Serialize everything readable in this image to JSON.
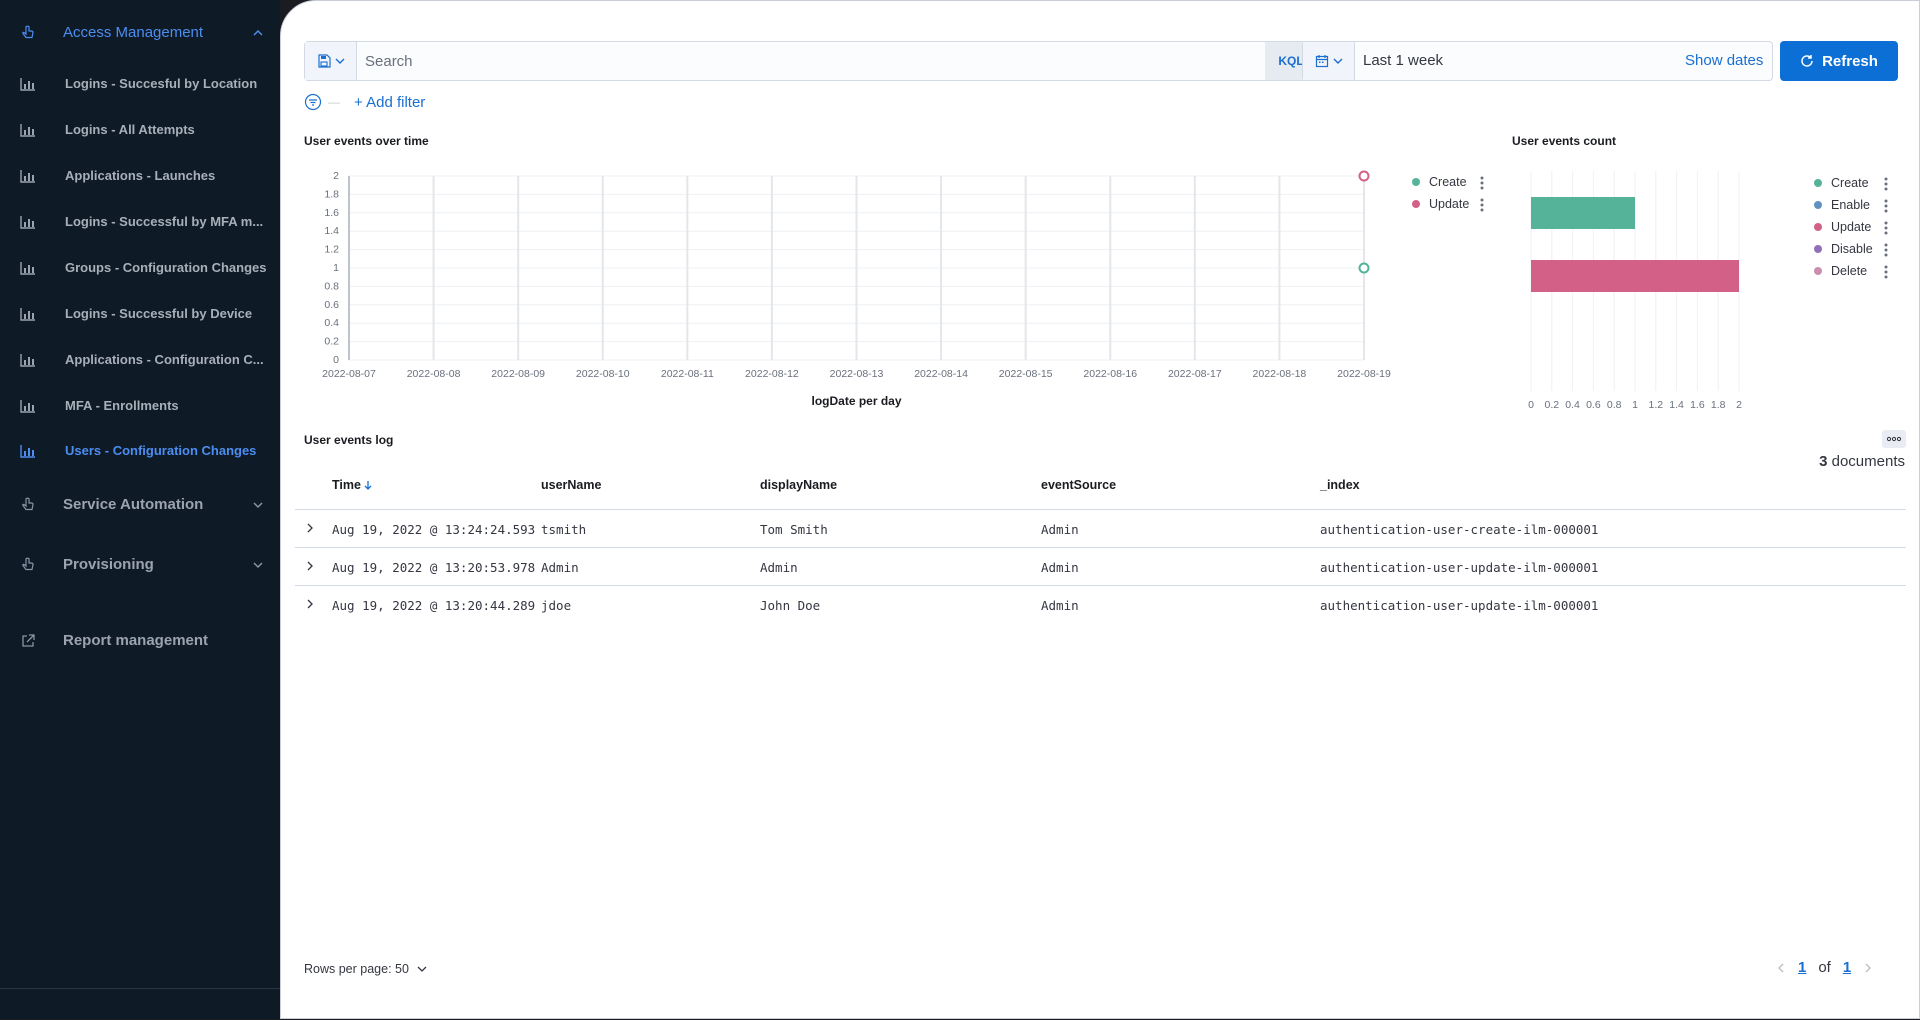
{
  "sidebar": {
    "sections": [
      {
        "label": "Access Management",
        "icon": "hand-pointer-icon",
        "expanded": true
      },
      {
        "label": "Service Automation",
        "icon": "hand-pointer-icon",
        "expanded": false
      },
      {
        "label": "Provisioning",
        "icon": "hand-pointer-icon",
        "expanded": false
      },
      {
        "label": "Report management",
        "icon": "external-link-icon"
      }
    ],
    "items": [
      {
        "label": "Logins - Succesful by Location",
        "icon": "bar-chart-icon"
      },
      {
        "label": "Logins - All Attempts",
        "icon": "bar-chart-icon"
      },
      {
        "label": "Applications - Launches",
        "icon": "bar-chart-icon"
      },
      {
        "label": "Logins - Successful by MFA m...",
        "icon": "bar-chart-icon"
      },
      {
        "label": "Groups - Configuration Changes",
        "icon": "bar-chart-icon"
      },
      {
        "label": "Logins - Successful by Device",
        "icon": "bar-chart-icon"
      },
      {
        "label": "Applications - Configuration C...",
        "icon": "bar-chart-icon"
      },
      {
        "label": "MFA - Enrollments",
        "icon": "bar-chart-icon"
      },
      {
        "label": "Users - Configuration Changes",
        "icon": "bar-chart-icon",
        "active": true
      }
    ]
  },
  "query_bar": {
    "search_placeholder": "Search",
    "language": "KQL",
    "time_range": "Last 1 week",
    "show_dates": "Show dates",
    "refresh": "Refresh",
    "add_filter": "+ Add filter"
  },
  "colors": {
    "accent": "#0b6fd6",
    "create": "#54b399",
    "update": "#d36086",
    "enable": "#6092c0",
    "disable": "#9170b8",
    "delete": "#ca8eae"
  },
  "chart_data": [
    {
      "type": "line",
      "title": "User events over time",
      "xlabel": "logDate per day",
      "ylabel": "",
      "x": [
        "2022-08-07",
        "2022-08-08",
        "2022-08-09",
        "2022-08-10",
        "2022-08-11",
        "2022-08-12",
        "2022-08-13",
        "2022-08-14",
        "2022-08-15",
        "2022-08-16",
        "2022-08-17",
        "2022-08-18",
        "2022-08-19"
      ],
      "yticks": [
        "0",
        "0.2",
        "0.4",
        "0.6",
        "0.8",
        "1",
        "1.2",
        "1.4",
        "1.6",
        "1.8",
        "2"
      ],
      "ylim": [
        0,
        2
      ],
      "series": [
        {
          "name": "Create",
          "points": [
            {
              "x": "2022-08-19",
              "y": 1
            }
          ]
        },
        {
          "name": "Update",
          "points": [
            {
              "x": "2022-08-19",
              "y": 2
            }
          ]
        }
      ],
      "legend": "right",
      "grid": true
    },
    {
      "type": "bar",
      "orientation": "horizontal",
      "title": "User events count",
      "categories": [
        "Create",
        "Update"
      ],
      "values": [
        1,
        2
      ],
      "xticks": [
        "0",
        "0.2",
        "0.4",
        "0.6",
        "0.8",
        "1",
        "1.2",
        "1.4",
        "1.6",
        "1.8",
        "2"
      ],
      "xlim": [
        0,
        2
      ],
      "legend_entries": [
        "Create",
        "Enable",
        "Update",
        "Disable",
        "Delete"
      ],
      "legend": "right",
      "grid": true
    }
  ],
  "log": {
    "title": "User events log",
    "count": "3",
    "count_label": "documents",
    "columns": [
      "Time",
      "userName",
      "displayName",
      "eventSource",
      "_index"
    ],
    "rows": [
      [
        "Aug 19, 2022 @ 13:24:24.593",
        "tsmith",
        "Tom Smith",
        "Admin",
        "authentication-user-create-ilm-000001"
      ],
      [
        "Aug 19, 2022 @ 13:20:53.978",
        "Admin",
        "Admin",
        "Admin",
        "authentication-user-update-ilm-000001"
      ],
      [
        "Aug 19, 2022 @ 13:20:44.289",
        "jdoe",
        "John Doe",
        "Admin",
        "authentication-user-update-ilm-000001"
      ]
    ],
    "rows_per_page": "Rows per page: 50",
    "pagination": {
      "current": "1",
      "of": "of",
      "total": "1"
    }
  }
}
